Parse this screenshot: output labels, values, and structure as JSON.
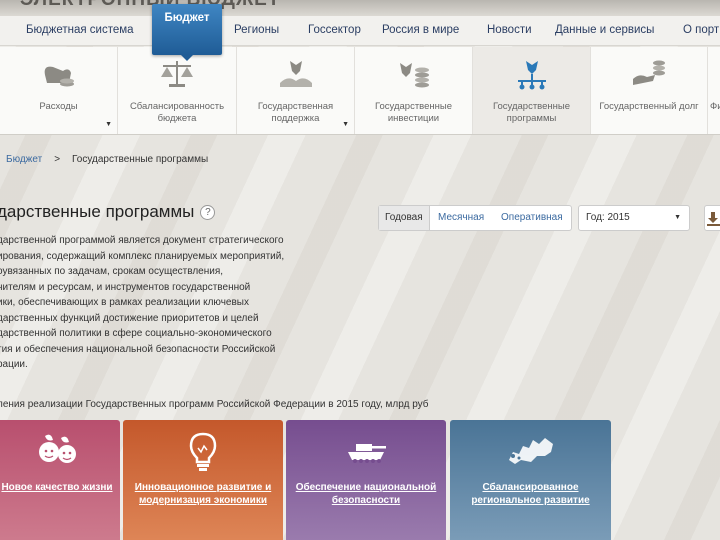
{
  "site": {
    "title": "ЭЛЕКТРОННЫЙ БЮДЖЕТ"
  },
  "nav": {
    "items": [
      "Бюджетная система",
      "Бюджет",
      "Регионы",
      "Госсектор",
      "Россия в мире",
      "Новости",
      "Данные и сервисы",
      "О порт"
    ],
    "active": "Бюджет"
  },
  "subnav": {
    "items": [
      {
        "label": "Расходы",
        "icon": "bag-coins-icon",
        "dropdown": true
      },
      {
        "label": "Сбаланси­рованность бюджета",
        "icon": "scales-icon",
        "dropdown": false
      },
      {
        "label": "Государственная поддержка",
        "icon": "eagle-hands-icon",
        "dropdown": true
      },
      {
        "label": "Государственные инвестиции",
        "icon": "eagle-coins-icon",
        "dropdown": false
      },
      {
        "label": "Государственные программы",
        "icon": "eagle-network-icon",
        "dropdown": false
      },
      {
        "label": "Государственный долг",
        "icon": "hand-coins-icon",
        "dropdown": false
      },
      {
        "label": "Фи",
        "icon": "",
        "dropdown": false
      }
    ],
    "dropdown_glyph": "▼"
  },
  "breadcrumb": {
    "root": "Бюджет",
    "separator": ">",
    "current": "Государственные программы"
  },
  "page": {
    "title": "дарственные программы",
    "help": "?",
    "description": [
      "дарственной программой является документ стратегического",
      "ирования, содержащий комплекс планируемых мероприятий,",
      "оувязанных по задачам, срокам осуществления,",
      "нителям и ресурсам, и инструментов государственной",
      "ики, обеспечивающих в рамках реализации ключевых",
      "дарственных функций достижение приоритетов и целей",
      "дарственной политики в сфере социально-экономического",
      "тия и обеспечения национальной безопасности Российской",
      "рации."
    ],
    "caption": "ления реализации Государственных программ Российской Федерации в 2015 году, млрд руб"
  },
  "controls": {
    "periods": [
      "Годовая",
      "Месячная",
      "Оперативная"
    ],
    "selected_period": "Годовая",
    "year_label": "Год: 2015",
    "year_caret": "▼"
  },
  "cards": [
    {
      "title": "Новое качество жизни",
      "icon": "children-icon",
      "color": "#b84f6e"
    },
    {
      "title": "Инновационное развитие и модернизация экономики",
      "icon": "lightbulb-icon",
      "color": "#c4582b"
    },
    {
      "title": "Обеспечение национальной безопасности",
      "icon": "tank-icon",
      "color": "#764d8f"
    },
    {
      "title": "Сбалансированное региональное развитие",
      "icon": "russia-map-icon",
      "color": "#4a7496"
    }
  ]
}
